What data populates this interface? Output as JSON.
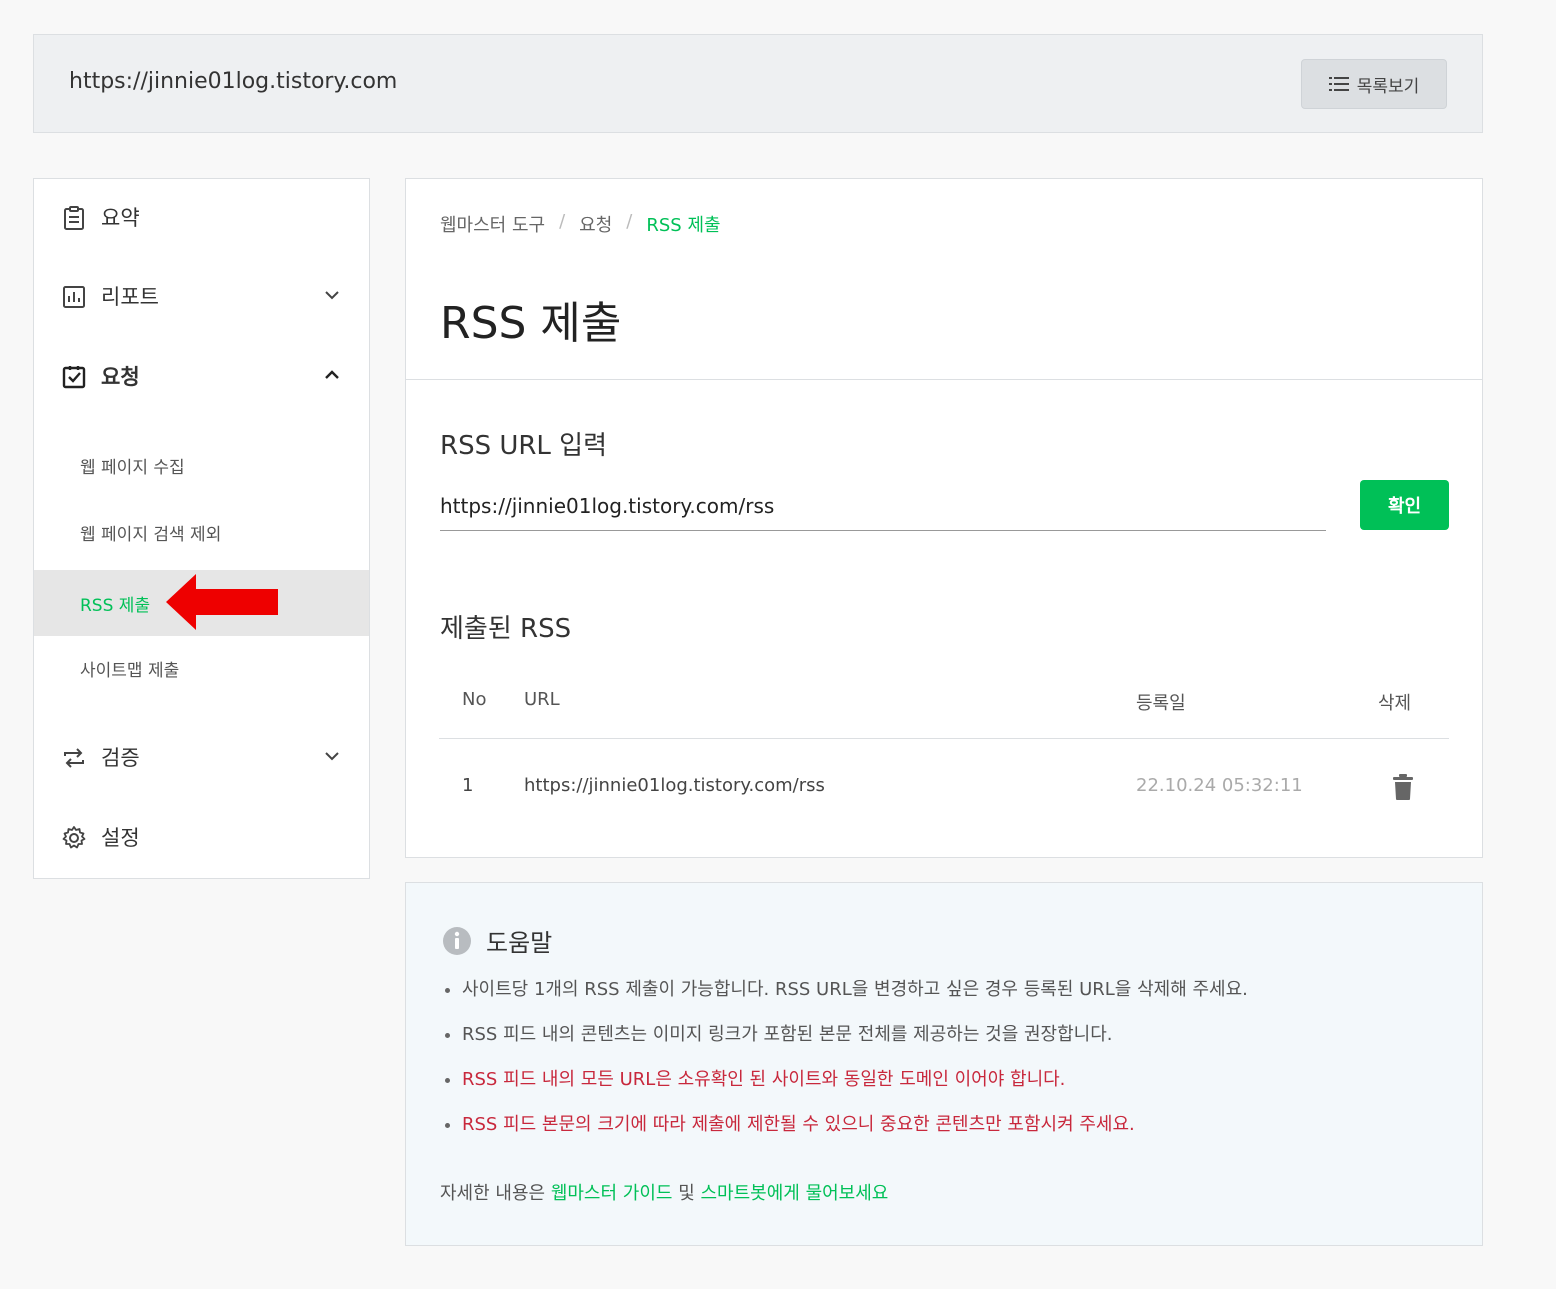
{
  "topbar": {
    "site_url": "https://jinnie01log.tistory.com",
    "list_button": "목록보기"
  },
  "sidebar": {
    "items": [
      {
        "label": "요약",
        "icon": "clipboard-icon"
      },
      {
        "label": "리포트",
        "icon": "chart-icon"
      },
      {
        "label": "요청",
        "icon": "check-square-icon"
      },
      {
        "label": "검증",
        "icon": "repeat-icon"
      },
      {
        "label": "설정",
        "icon": "gear-icon"
      }
    ],
    "sub_items": [
      {
        "label": "웹 페이지 수집"
      },
      {
        "label": "웹 페이지 검색 제외"
      },
      {
        "label": "RSS 제출"
      },
      {
        "label": "사이트맵 제출"
      }
    ]
  },
  "breadcrumb": {
    "items": [
      "웹마스터 도구",
      "요청",
      "RSS 제출"
    ],
    "separator": "/"
  },
  "main": {
    "title": "RSS 제출",
    "input_label": "RSS URL 입력",
    "input_value": "https://jinnie01log.tistory.com/rss",
    "confirm_label": "확인",
    "submitted_label": "제출된 RSS",
    "table": {
      "headers": [
        "No",
        "URL",
        "등록일",
        "삭제"
      ],
      "rows": [
        {
          "no": "1",
          "url": "https://jinnie01log.tistory.com/rss",
          "date": "22.10.24 05:32:11"
        }
      ]
    }
  },
  "help": {
    "title": "도움말",
    "items": [
      "사이트당 1개의 RSS 제출이 가능합니다. RSS URL을 변경하고 싶은 경우 등록된 URL을 삭제해 주세요.",
      "RSS 피드 내의 콘텐츠는 이미지 링크가 포함된 본문 전체를 제공하는 것을 권장합니다.",
      "RSS 피드 내의 모든 URL은 소유확인 된 사이트와 동일한 도메인 이어야 합니다.",
      "RSS 피드 본문의 크기에 따라 제출에 제한될 수 있으니 중요한 콘텐츠만 포함시켜 주세요."
    ],
    "footer_prefix": "자세한 내용은 ",
    "footer_link1": "웹마스터 가이드",
    "footer_mid": " 및 ",
    "footer_link2": "스마트봇에게 물어보세요"
  },
  "colors": {
    "accent": "#00c057",
    "warning": "#c8283c",
    "arrow": "#ee0000"
  }
}
